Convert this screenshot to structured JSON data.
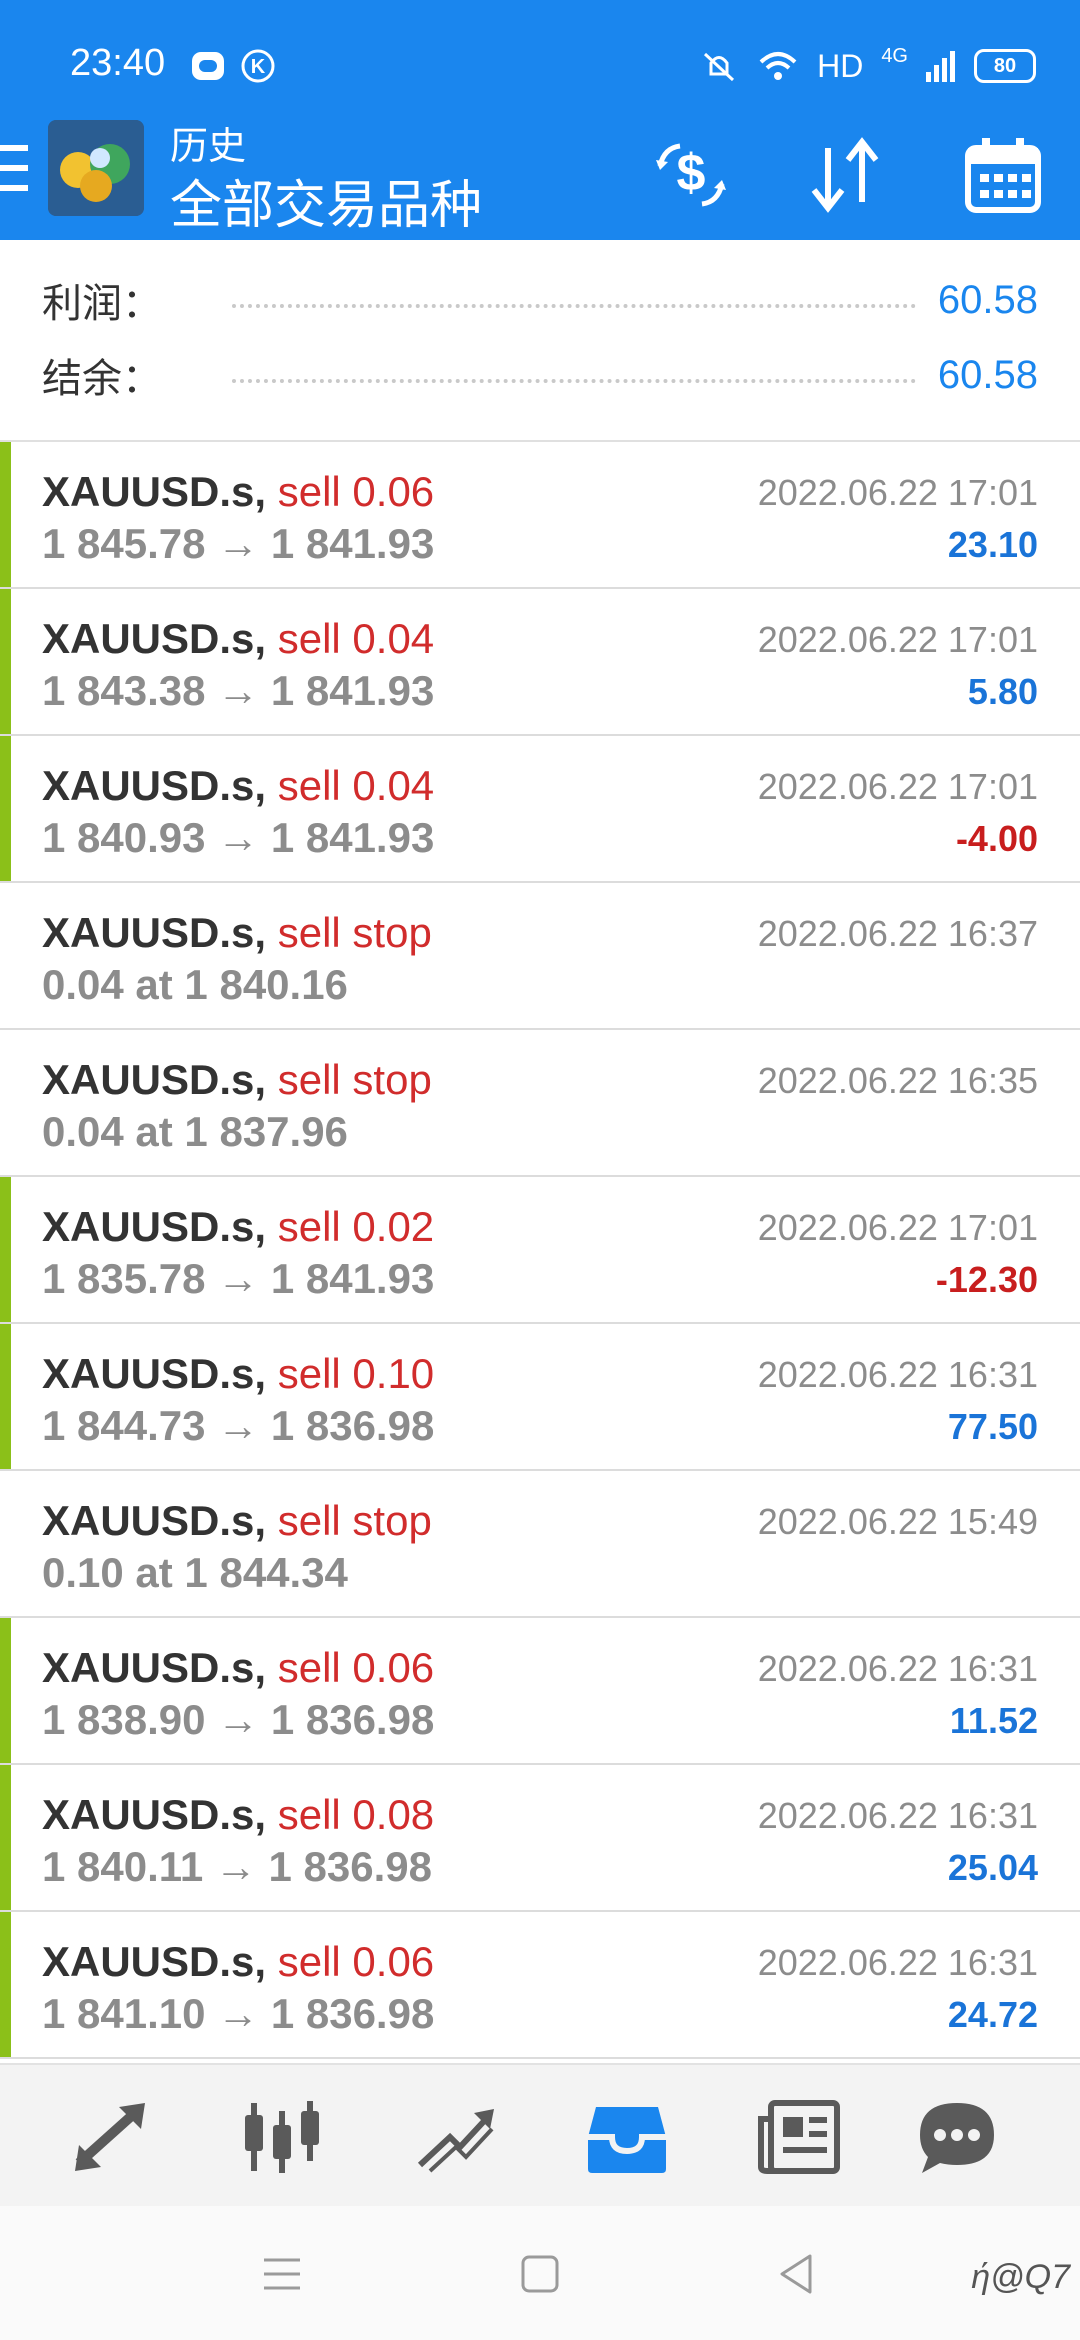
{
  "status_bar": {
    "time": "23:40",
    "network": "HD",
    "network_gen": "4G",
    "battery": "80",
    "icons": [
      "app-icon",
      "k-icon",
      "mute-icon",
      "wifi-icon",
      "signal-icon"
    ]
  },
  "app_bar": {
    "subtitle": "历史",
    "title": "全部交易品种",
    "actions": [
      "currency-exchange-icon",
      "sort-icon",
      "calendar-icon"
    ]
  },
  "summary": {
    "profit_label": "利润：",
    "profit_value": "60.58",
    "balance_label": "结余：",
    "balance_value": "60.58"
  },
  "trades": [
    {
      "symbol": "XAUUSD.s,",
      "type": "sell 0.06",
      "price": "1 845.78 → 1 841.93",
      "time": "2022.06.22 17:01",
      "profit": "23.10",
      "bar": true
    },
    {
      "symbol": "XAUUSD.s,",
      "type": "sell 0.04",
      "price": "1 843.38 → 1 841.93",
      "time": "2022.06.22 17:01",
      "profit": "5.80",
      "bar": true
    },
    {
      "symbol": "XAUUSD.s,",
      "type": "sell 0.04",
      "price": "1 840.93 → 1 841.93",
      "time": "2022.06.22 17:01",
      "profit": "-4.00",
      "bar": true
    },
    {
      "symbol": "XAUUSD.s,",
      "type": "sell stop",
      "price": "0.04 at 1 840.16",
      "time": "2022.06.22 16:37",
      "profit": "",
      "bar": false
    },
    {
      "symbol": "XAUUSD.s,",
      "type": "sell stop",
      "price": "0.04 at 1 837.96",
      "time": "2022.06.22 16:35",
      "profit": "",
      "bar": false
    },
    {
      "symbol": "XAUUSD.s,",
      "type": "sell 0.02",
      "price": "1 835.78 → 1 841.93",
      "time": "2022.06.22 17:01",
      "profit": "-12.30",
      "bar": true
    },
    {
      "symbol": "XAUUSD.s,",
      "type": "sell 0.10",
      "price": "1 844.73 → 1 836.98",
      "time": "2022.06.22 16:31",
      "profit": "77.50",
      "bar": true
    },
    {
      "symbol": "XAUUSD.s,",
      "type": "sell stop",
      "price": "0.10 at 1 844.34",
      "time": "2022.06.22 15:49",
      "profit": "",
      "bar": false
    },
    {
      "symbol": "XAUUSD.s,",
      "type": "sell 0.06",
      "price": "1 838.90 → 1 836.98",
      "time": "2022.06.22 16:31",
      "profit": "11.52",
      "bar": true
    },
    {
      "symbol": "XAUUSD.s,",
      "type": "sell 0.08",
      "price": "1 840.11 → 1 836.98",
      "time": "2022.06.22 16:31",
      "profit": "25.04",
      "bar": true
    },
    {
      "symbol": "XAUUSD.s,",
      "type": "sell 0.06",
      "price": "1 841.10 → 1 836.98",
      "time": "2022.06.22 16:31",
      "profit": "24.72",
      "bar": true
    }
  ],
  "bottom_nav": {
    "items": [
      "quotes-icon",
      "chart-icon",
      "trade-icon",
      "history-icon",
      "news-icon",
      "chat-icon"
    ],
    "active": "history-icon"
  },
  "system_nav": {
    "items": [
      "menu-icon",
      "home-icon",
      "back-icon"
    ],
    "watermark": "ή@Q7"
  },
  "colors": {
    "accent": "#1a86ee",
    "sell": "#d12c2c",
    "positive": "#1a74d8",
    "negative": "#c81e1e",
    "closed_bar": "#8bc019"
  }
}
